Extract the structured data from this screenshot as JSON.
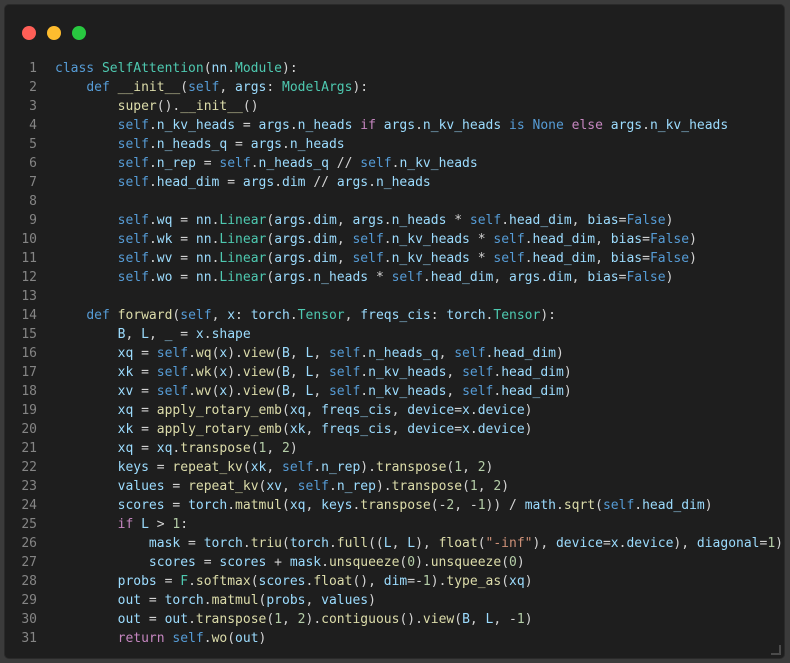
{
  "editor": {
    "language": "python",
    "colors": {
      "background": "#1e1e1e",
      "keyword": "#569cd6",
      "control_keyword": "#c586c0",
      "function": "#dcdcaa",
      "class": "#4ec9b0",
      "number": "#b5cea8",
      "string": "#ce9178",
      "variable": "#9cdcfe",
      "line_number": "#858585"
    },
    "window_buttons": [
      "close-button",
      "minimize-button",
      "maximize-button"
    ],
    "lines": [
      {
        "n": "1",
        "code": "class SelfAttention(nn.Module):"
      },
      {
        "n": "2",
        "code": "    def __init__(self, args: ModelArgs):"
      },
      {
        "n": "3",
        "code": "        super().__init__()"
      },
      {
        "n": "4",
        "code": "        self.n_kv_heads = args.n_heads if args.n_kv_heads is None else args.n_kv_heads"
      },
      {
        "n": "5",
        "code": "        self.n_heads_q = args.n_heads"
      },
      {
        "n": "6",
        "code": "        self.n_rep = self.n_heads_q // self.n_kv_heads"
      },
      {
        "n": "7",
        "code": "        self.head_dim = args.dim // args.n_heads"
      },
      {
        "n": "8",
        "code": ""
      },
      {
        "n": "9",
        "code": "        self.wq = nn.Linear(args.dim, args.n_heads * self.head_dim, bias=False)"
      },
      {
        "n": "10",
        "code": "        self.wk = nn.Linear(args.dim, self.n_kv_heads * self.head_dim, bias=False)"
      },
      {
        "n": "11",
        "code": "        self.wv = nn.Linear(args.dim, self.n_kv_heads * self.head_dim, bias=False)"
      },
      {
        "n": "12",
        "code": "        self.wo = nn.Linear(args.n_heads * self.head_dim, args.dim, bias=False)"
      },
      {
        "n": "13",
        "code": ""
      },
      {
        "n": "14",
        "code": "    def forward(self, x: torch.Tensor, freqs_cis: torch.Tensor):"
      },
      {
        "n": "15",
        "code": "        B, L, _ = x.shape"
      },
      {
        "n": "16",
        "code": "        xq = self.wq(x).view(B, L, self.n_heads_q, self.head_dim)"
      },
      {
        "n": "17",
        "code": "        xk = self.wk(x).view(B, L, self.n_kv_heads, self.head_dim)"
      },
      {
        "n": "18",
        "code": "        xv = self.wv(x).view(B, L, self.n_kv_heads, self.head_dim)"
      },
      {
        "n": "19",
        "code": "        xq = apply_rotary_emb(xq, freqs_cis, device=x.device)"
      },
      {
        "n": "20",
        "code": "        xk = apply_rotary_emb(xk, freqs_cis, device=x.device)"
      },
      {
        "n": "21",
        "code": "        xq = xq.transpose(1, 2)"
      },
      {
        "n": "22",
        "code": "        keys = repeat_kv(xk, self.n_rep).transpose(1, 2)"
      },
      {
        "n": "23",
        "code": "        values = repeat_kv(xv, self.n_rep).transpose(1, 2)"
      },
      {
        "n": "24",
        "code": "        scores = torch.matmul(xq, keys.transpose(-2, -1)) / math.sqrt(self.head_dim)"
      },
      {
        "n": "25",
        "code": "        if L > 1:"
      },
      {
        "n": "26",
        "code": "            mask = torch.triu(torch.full((L, L), float(\"-inf\"), device=x.device), diagonal=1)"
      },
      {
        "n": "27",
        "code": "            scores = scores + mask.unsqueeze(0).unsqueeze(0)"
      },
      {
        "n": "28",
        "code": "        probs = F.softmax(scores.float(), dim=-1).type_as(xq)"
      },
      {
        "n": "29",
        "code": "        out = torch.matmul(probs, values)"
      },
      {
        "n": "30",
        "code": "        out = out.transpose(1, 2).contiguous().view(B, L, -1)"
      },
      {
        "n": "31",
        "code": "        return self.wo(out)"
      }
    ]
  }
}
